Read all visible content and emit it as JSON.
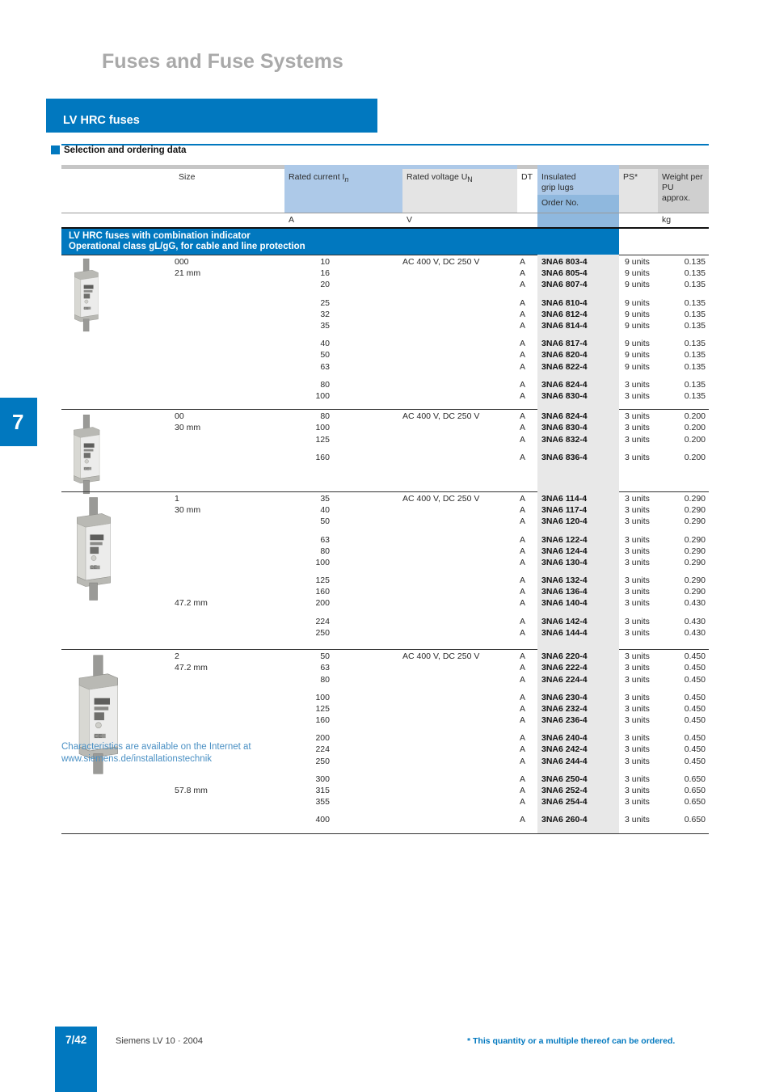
{
  "page_title": "Fuses and Fuse Systems",
  "section": {
    "title": "LV HRC fuses",
    "subsection": "Selection and ordering data"
  },
  "table": {
    "headers": {
      "size": "Size",
      "rated_current": "Rated current I",
      "rated_current_sub": "n",
      "rated_voltage": "Rated voltage U",
      "rated_voltage_sub": "N",
      "dt": "DT",
      "insulated_grip_lugs_l1": "Insulated",
      "insulated_grip_lugs_l2": "grip lugs",
      "order_no": "Order No.",
      "ps": "PS*",
      "weight_l1": "Weight per",
      "weight_l2": "PU",
      "weight_l3": "approx."
    },
    "units": {
      "current": "A",
      "voltage": "V",
      "weight": "kg"
    },
    "group_band": {
      "line1": "LV HRC fuses with combination indicator",
      "line2": "Operational class gL/gG, for cable and line protection"
    },
    "groups": [
      {
        "image_name": "fuse-size-000",
        "blocks": [
          [
            {
              "size": "000",
              "current": "10",
              "voltage": "AC 400 V, DC 250 V",
              "dt": "A",
              "order": "3NA6 803-4",
              "ps": "9 units",
              "weight": "0.135"
            },
            {
              "size": "21 mm",
              "current": "16",
              "voltage": "",
              "dt": "A",
              "order": "3NA6 805-4",
              "ps": "9 units",
              "weight": "0.135"
            },
            {
              "size": "",
              "current": "20",
              "voltage": "",
              "dt": "A",
              "order": "3NA6 807-4",
              "ps": "9 units",
              "weight": "0.135"
            }
          ],
          [
            {
              "size": "",
              "current": "25",
              "voltage": "",
              "dt": "A",
              "order": "3NA6 810-4",
              "ps": "9 units",
              "weight": "0.135"
            },
            {
              "size": "",
              "current": "32",
              "voltage": "",
              "dt": "A",
              "order": "3NA6 812-4",
              "ps": "9 units",
              "weight": "0.135"
            },
            {
              "size": "",
              "current": "35",
              "voltage": "",
              "dt": "A",
              "order": "3NA6 814-4",
              "ps": "9 units",
              "weight": "0.135"
            }
          ],
          [
            {
              "size": "",
              "current": "40",
              "voltage": "",
              "dt": "A",
              "order": "3NA6 817-4",
              "ps": "9 units",
              "weight": "0.135"
            },
            {
              "size": "",
              "current": "50",
              "voltage": "",
              "dt": "A",
              "order": "3NA6 820-4",
              "ps": "9 units",
              "weight": "0.135"
            },
            {
              "size": "",
              "current": "63",
              "voltage": "",
              "dt": "A",
              "order": "3NA6 822-4",
              "ps": "9 units",
              "weight": "0.135"
            }
          ],
          [
            {
              "size": "",
              "current": "80",
              "voltage": "",
              "dt": "A",
              "order": "3NA6 824-4",
              "ps": "3 units",
              "weight": "0.135"
            },
            {
              "size": "",
              "current": "100",
              "voltage": "",
              "dt": "A",
              "order": "3NA6 830-4",
              "ps": "3 units",
              "weight": "0.135"
            }
          ]
        ]
      },
      {
        "image_name": "fuse-size-00",
        "blocks": [
          [
            {
              "size": "00",
              "current": "80",
              "voltage": "AC 400 V, DC 250 V",
              "dt": "A",
              "order": "3NA6 824-4",
              "ps": "3 units",
              "weight": "0.200"
            },
            {
              "size": "30 mm",
              "current": "100",
              "voltage": "",
              "dt": "A",
              "order": "3NA6 830-4",
              "ps": "3 units",
              "weight": "0.200"
            },
            {
              "size": "",
              "current": "125",
              "voltage": "",
              "dt": "A",
              "order": "3NA6 832-4",
              "ps": "3 units",
              "weight": "0.200"
            }
          ],
          [
            {
              "size": "",
              "current": "160",
              "voltage": "",
              "dt": "A",
              "order": "3NA6 836-4",
              "ps": "3 units",
              "weight": "0.200"
            }
          ]
        ]
      },
      {
        "image_name": "fuse-size-1",
        "blocks": [
          [
            {
              "size": "1",
              "current": "35",
              "voltage": "AC 400 V, DC 250 V",
              "dt": "A",
              "order": "3NA6 114-4",
              "ps": "3 units",
              "weight": "0.290"
            },
            {
              "size": "30 mm",
              "current": "40",
              "voltage": "",
              "dt": "A",
              "order": "3NA6 117-4",
              "ps": "3 units",
              "weight": "0.290"
            },
            {
              "size": "",
              "current": "50",
              "voltage": "",
              "dt": "A",
              "order": "3NA6 120-4",
              "ps": "3 units",
              "weight": "0.290"
            }
          ],
          [
            {
              "size": "",
              "current": "63",
              "voltage": "",
              "dt": "A",
              "order": "3NA6 122-4",
              "ps": "3 units",
              "weight": "0.290"
            },
            {
              "size": "",
              "current": "80",
              "voltage": "",
              "dt": "A",
              "order": "3NA6 124-4",
              "ps": "3 units",
              "weight": "0.290"
            },
            {
              "size": "",
              "current": "100",
              "voltage": "",
              "dt": "A",
              "order": "3NA6 130-4",
              "ps": "3 units",
              "weight": "0.290"
            }
          ],
          [
            {
              "size": "",
              "current": "125",
              "voltage": "",
              "dt": "A",
              "order": "3NA6 132-4",
              "ps": "3 units",
              "weight": "0.290"
            },
            {
              "size": "",
              "current": "160",
              "voltage": "",
              "dt": "A",
              "order": "3NA6 136-4",
              "ps": "3 units",
              "weight": "0.290"
            },
            {
              "size": "47.2 mm",
              "current": "200",
              "voltage": "",
              "dt": "A",
              "order": "3NA6 140-4",
              "ps": "3 units",
              "weight": "0.430"
            }
          ],
          [
            {
              "size": "",
              "current": "224",
              "voltage": "",
              "dt": "A",
              "order": "3NA6 142-4",
              "ps": "3 units",
              "weight": "0.430"
            },
            {
              "size": "",
              "current": "250",
              "voltage": "",
              "dt": "A",
              "order": "3NA6 144-4",
              "ps": "3 units",
              "weight": "0.430"
            }
          ]
        ]
      },
      {
        "image_name": "fuse-size-2",
        "blocks": [
          [
            {
              "size": "2",
              "current": "50",
              "voltage": "AC 400 V, DC 250 V",
              "dt": "A",
              "order": "3NA6 220-4",
              "ps": "3 units",
              "weight": "0.450"
            },
            {
              "size": "47.2 mm",
              "current": "63",
              "voltage": "",
              "dt": "A",
              "order": "3NA6 222-4",
              "ps": "3 units",
              "weight": "0.450"
            },
            {
              "size": "",
              "current": "80",
              "voltage": "",
              "dt": "A",
              "order": "3NA6 224-4",
              "ps": "3 units",
              "weight": "0.450"
            }
          ],
          [
            {
              "size": "",
              "current": "100",
              "voltage": "",
              "dt": "A",
              "order": "3NA6 230-4",
              "ps": "3 units",
              "weight": "0.450"
            },
            {
              "size": "",
              "current": "125",
              "voltage": "",
              "dt": "A",
              "order": "3NA6 232-4",
              "ps": "3 units",
              "weight": "0.450"
            },
            {
              "size": "",
              "current": "160",
              "voltage": "",
              "dt": "A",
              "order": "3NA6 236-4",
              "ps": "3 units",
              "weight": "0.450"
            }
          ],
          [
            {
              "size": "",
              "current": "200",
              "voltage": "",
              "dt": "A",
              "order": "3NA6 240-4",
              "ps": "3 units",
              "weight": "0.450"
            },
            {
              "size": "",
              "current": "224",
              "voltage": "",
              "dt": "A",
              "order": "3NA6 242-4",
              "ps": "3 units",
              "weight": "0.450"
            },
            {
              "size": "",
              "current": "250",
              "voltage": "",
              "dt": "A",
              "order": "3NA6 244-4",
              "ps": "3 units",
              "weight": "0.450"
            }
          ],
          [
            {
              "size": "",
              "current": "300",
              "voltage": "",
              "dt": "A",
              "order": "3NA6 250-4",
              "ps": "3 units",
              "weight": "0.650"
            },
            {
              "size": "57.8 mm",
              "current": "315",
              "voltage": "",
              "dt": "A",
              "order": "3NA6 252-4",
              "ps": "3 units",
              "weight": "0.650"
            },
            {
              "size": "",
              "current": "355",
              "voltage": "",
              "dt": "A",
              "order": "3NA6 254-4",
              "ps": "3 units",
              "weight": "0.650"
            }
          ],
          [
            {
              "size": "",
              "current": "400",
              "voltage": "",
              "dt": "A",
              "order": "3NA6 260-4",
              "ps": "3 units",
              "weight": "0.650"
            }
          ]
        ]
      }
    ]
  },
  "notes": {
    "internet_line1": "Characteristics are available on the Internet at",
    "internet_line2": "www.siemens.de/installationstechnik"
  },
  "chapter_tab": "7",
  "footer": {
    "page_number": "7/42",
    "source": "Siemens LV 10 · 2004",
    "footnote": "* This quantity or a multiple thereof can be ordered."
  },
  "colors": {
    "brand_blue": "#0178bf",
    "header_blue_light": "#adc9e8",
    "header_blue_mid": "#8fb8de",
    "header_grey": "#e4e4e4",
    "order_col_grey": "#e8e8e8",
    "title_grey": "#a9a9a9",
    "link_blue": "#4a90c4"
  }
}
